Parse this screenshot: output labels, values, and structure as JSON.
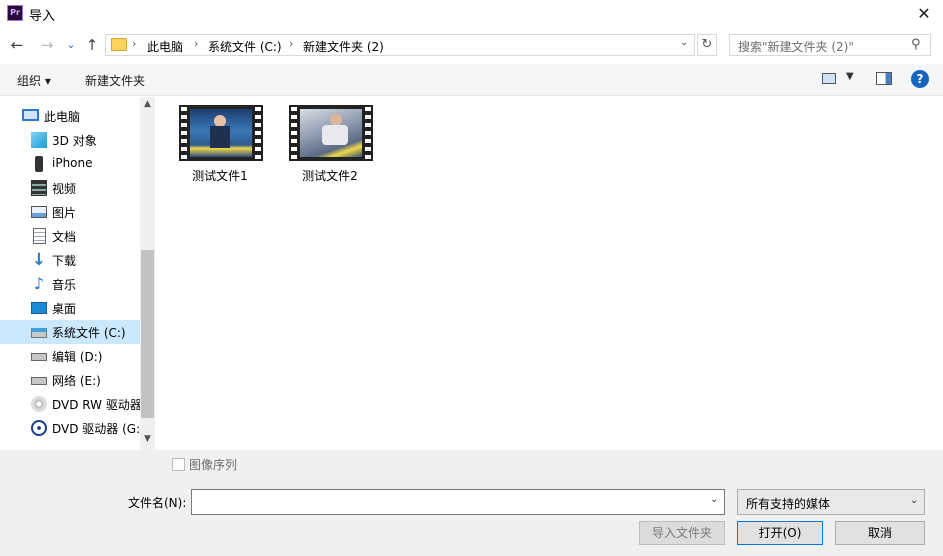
{
  "window": {
    "title": "导入",
    "app_icon_text": "Pr",
    "close_glyph": "✕"
  },
  "nav": {
    "back": "←",
    "forward": "→",
    "recent": "⌄",
    "up": "↑"
  },
  "address": {
    "crumbs": [
      "此电脑",
      "系统文件 (C:)",
      "新建文件夹 (2)"
    ],
    "separator": "›",
    "refresh": "↻"
  },
  "search": {
    "placeholder": "搜索\"新建文件夹 (2)\"",
    "icon": "search-icon"
  },
  "toolbar": {
    "organize": "组织 ▾",
    "new_folder": "新建文件夹",
    "help": "?"
  },
  "sidebar": {
    "items": [
      {
        "label": "此电脑",
        "icon": "computer-icon"
      },
      {
        "label": "3D 对象",
        "icon": "cube-icon"
      },
      {
        "label": "iPhone",
        "icon": "phone-icon"
      },
      {
        "label": "视频",
        "icon": "video-icon"
      },
      {
        "label": "图片",
        "icon": "picture-icon"
      },
      {
        "label": "文档",
        "icon": "document-icon"
      },
      {
        "label": "下载",
        "icon": "download-icon"
      },
      {
        "label": "音乐",
        "icon": "music-icon"
      },
      {
        "label": "桌面",
        "icon": "desktop-icon"
      },
      {
        "label": "系统文件 (C:)",
        "icon": "system-drive-icon",
        "selected": true
      },
      {
        "label": "编辑 (D:)",
        "icon": "drive-icon"
      },
      {
        "label": "网络 (E:)",
        "icon": "drive-icon"
      },
      {
        "label": "DVD RW 驱动器",
        "icon": "dvd-rw-icon"
      },
      {
        "label": "DVD 驱动器 (G:",
        "icon": "dvd-icon"
      }
    ]
  },
  "files": [
    {
      "name": "测试文件1",
      "icon": "video-thumbnail"
    },
    {
      "name": "测试文件2",
      "icon": "video-thumbnail"
    }
  ],
  "options": {
    "image_sequence": "图像序列",
    "image_sequence_checked": false
  },
  "filename": {
    "label": "文件名(N):",
    "value": ""
  },
  "filetype": {
    "selected": "所有支持的媒体"
  },
  "buttons": {
    "import_folder": "导入文件夹",
    "open": "打开(O)",
    "cancel": "取消"
  },
  "colors": {
    "selection": "#cce8ff",
    "accent": "#0078d7"
  }
}
